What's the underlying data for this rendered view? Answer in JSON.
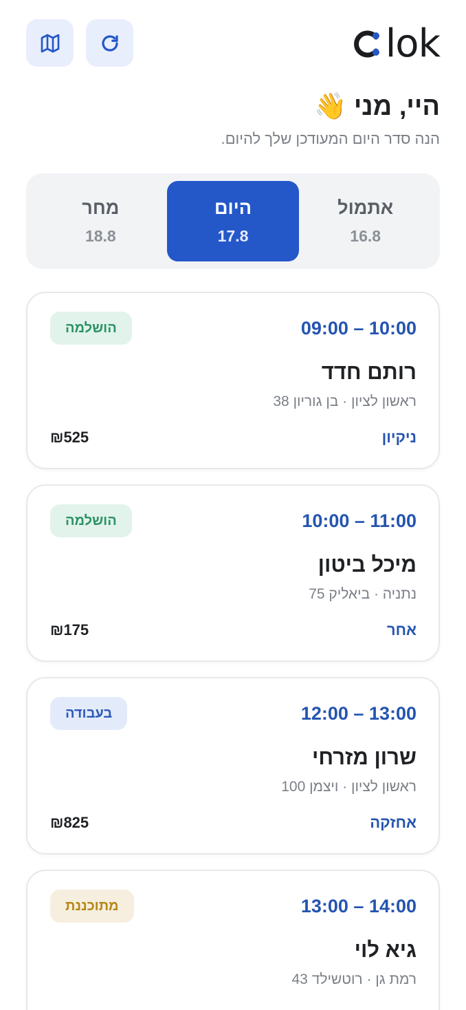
{
  "header": {
    "logo_text": "lok",
    "map_icon": "map-icon",
    "refresh_icon": "refresh-icon",
    "brand_color": "#2457c8"
  },
  "greeting": {
    "title": "היי, מני",
    "emoji": "👋",
    "subtitle": "הנה סדר היום המעודכן שלך להיום."
  },
  "days": [
    {
      "name": "אתמול",
      "date": "16.8",
      "active": false
    },
    {
      "name": "היום",
      "date": "17.8",
      "active": true
    },
    {
      "name": "מחר",
      "date": "18.8",
      "active": false
    }
  ],
  "appointments": [
    {
      "time": "09:00 – 10:00",
      "status": "הושלמה",
      "name": "רותם חדד",
      "address": "ראשון לציון · בן גוריון 38",
      "service": "ניקיון",
      "price": "₪525"
    },
    {
      "time": "10:00 – 11:00",
      "status": "הושלמה",
      "name": "מיכל ביטון",
      "address": "נתניה · ביאליק 75",
      "service": "אחר",
      "price": "₪175"
    },
    {
      "time": "12:00 – 13:00",
      "status": "בעבודה",
      "name": "שרון מזרחי",
      "address": "ראשון לציון · ויצמן 100",
      "service": "אחזקה",
      "price": "₪825"
    },
    {
      "time": "13:00 – 14:00",
      "status": "מתוכננת",
      "name": "גיא לוי",
      "address": "רמת גן · רוטשילד 43",
      "service": "",
      "price": ""
    }
  ]
}
